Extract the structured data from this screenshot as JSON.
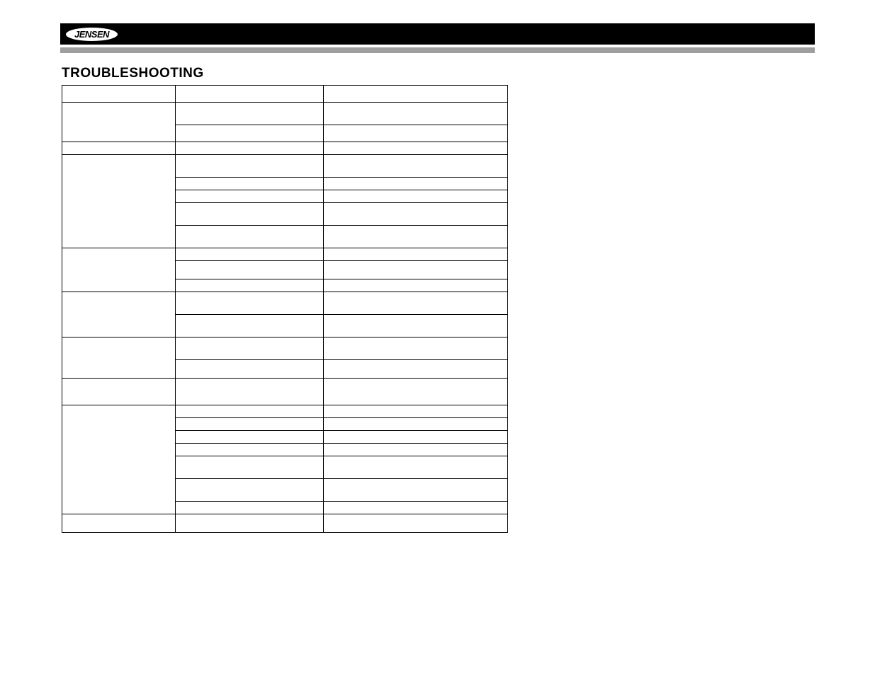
{
  "header": {
    "brand": "JENSEN"
  },
  "heading": "TROUBLESHOOTING",
  "table": {
    "columns": [
      "",
      "",
      ""
    ],
    "rows": [
      {
        "c1": "",
        "c2": "",
        "c3": "",
        "h": "h24"
      },
      {
        "c1": "",
        "c2": "",
        "c3": "",
        "h": "h32",
        "span": 2,
        "r2c2": "",
        "r2c3": "",
        "h2": "h24"
      },
      {
        "c1": "",
        "c2": "",
        "c3": "",
        "h": "h18"
      },
      {
        "c1": "",
        "group": [
          {
            "c2": "",
            "c3": "",
            "h": "h32"
          },
          {
            "c2": "",
            "c3": "",
            "h": "h18"
          },
          {
            "c2": "",
            "c3": "",
            "h": "h18"
          },
          {
            "c2": "",
            "c3": "",
            "h": "h32"
          },
          {
            "c2": "",
            "c3": "",
            "h": "h32"
          }
        ]
      },
      {
        "c1": "",
        "group": [
          {
            "c2": "",
            "c3": "",
            "h": "h18"
          },
          {
            "c2": "",
            "c3": "",
            "h": "h26"
          },
          {
            "c2": "",
            "c3": "",
            "h": "h18"
          }
        ]
      },
      {
        "c1": "",
        "group": [
          {
            "c2": "",
            "c3": "",
            "h": "h32"
          },
          {
            "c2": "",
            "c3": "",
            "h": "h32"
          }
        ]
      },
      {
        "c1": "",
        "group": [
          {
            "c2": "",
            "c3": "",
            "h": "h32"
          },
          {
            "c2": "",
            "c3": "",
            "h": "h26"
          }
        ]
      },
      {
        "c1": "",
        "c2": "",
        "c3": "",
        "h": "h38"
      },
      {
        "c1": "",
        "group": [
          {
            "c2": "",
            "c3": "",
            "h": "h18"
          },
          {
            "c2": "",
            "c3": "",
            "h": "h18"
          },
          {
            "c2": "",
            "c3": "",
            "h": "h18"
          },
          {
            "c2": "",
            "c3": "",
            "h": "h18"
          },
          {
            "c2": "",
            "c3": "",
            "h": "h32"
          },
          {
            "c2": "",
            "c3": "",
            "h": "h32"
          },
          {
            "c2": "",
            "c3": "",
            "h": "h18"
          }
        ]
      },
      {
        "c1": "",
        "c2": "",
        "c3": "",
        "h": "h26"
      }
    ]
  }
}
